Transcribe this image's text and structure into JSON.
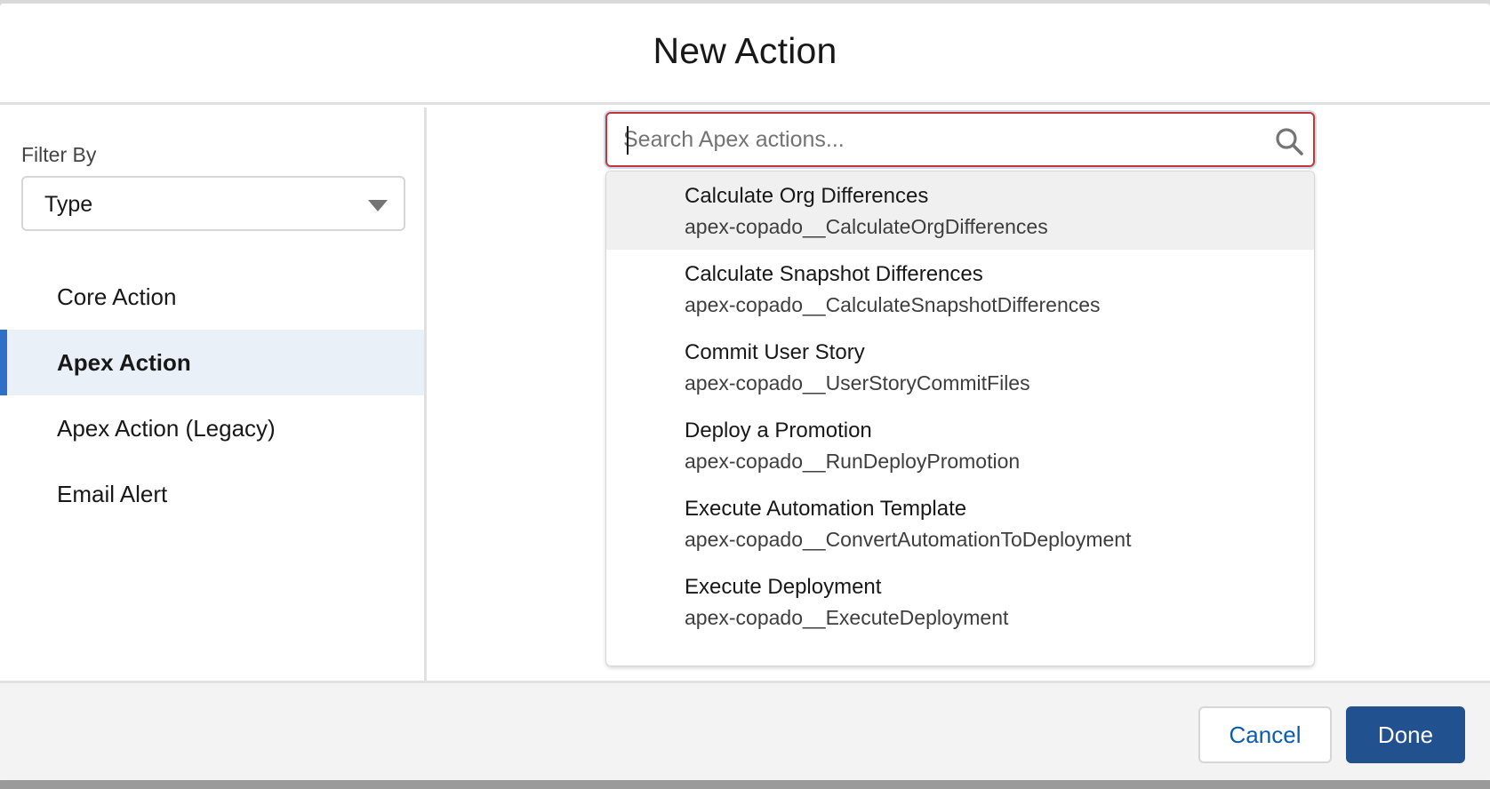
{
  "modal": {
    "title": "New Action"
  },
  "sidebar": {
    "filter_label": "Filter By",
    "filter_value": "Type",
    "items": [
      {
        "label": "Core Action",
        "active": false
      },
      {
        "label": "Apex Action",
        "active": true
      },
      {
        "label": "Apex Action (Legacy)",
        "active": false
      },
      {
        "label": "Email Alert",
        "active": false
      }
    ]
  },
  "search": {
    "placeholder": "Search Apex actions...",
    "value": ""
  },
  "results": [
    {
      "label": "Calculate Org Differences",
      "meta": "apex-copado__CalculateOrgDifferences"
    },
    {
      "label": "Calculate Snapshot Differences",
      "meta": "apex-copado__CalculateSnapshotDifferences"
    },
    {
      "label": "Commit User Story",
      "meta": "apex-copado__UserStoryCommitFiles"
    },
    {
      "label": "Deploy a Promotion",
      "meta": "apex-copado__RunDeployPromotion"
    },
    {
      "label": "Execute Automation Template",
      "meta": "apex-copado__ConvertAutomationToDeployment"
    },
    {
      "label": "Execute Deployment",
      "meta": "apex-copado__ExecuteDeployment"
    }
  ],
  "footer": {
    "cancel_label": "Cancel",
    "done_label": "Done"
  },
  "colors": {
    "accent": "#2f6fc8",
    "primary_button": "#22518f",
    "search_border": "#c23934"
  }
}
